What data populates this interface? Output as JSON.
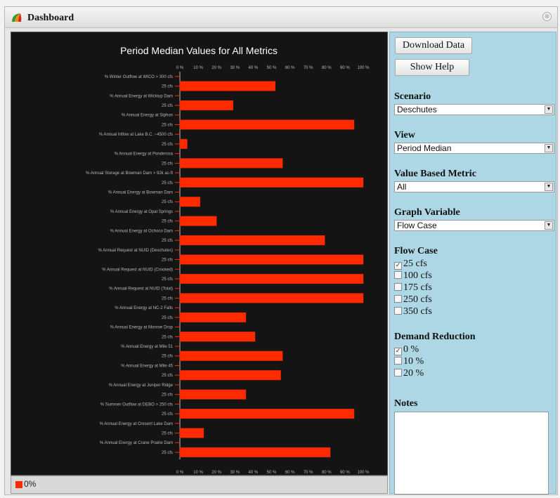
{
  "window": {
    "title": "Dashboard",
    "close_glyph": "⊗"
  },
  "icons": {
    "app": "app-logo-icon",
    "close": "close-icon",
    "dropdown": "dropdown-arrow-icon"
  },
  "chart_data": {
    "type": "bar",
    "orientation": "horizontal",
    "title": "Period Median Values  for All Metrics",
    "xlim": [
      0,
      100
    ],
    "x_ticks": [
      "0 %",
      "10 %",
      "20 %",
      "30 %",
      "40 %",
      "50 %",
      "60 %",
      "70 %",
      "80 %",
      "90 %",
      "100 %"
    ],
    "categories": [
      "% Winter Outflow at WICO > 300 cfs",
      "25 cfs",
      "% Annual Energy at Wickiup Dam",
      "25 cfs",
      "% Annual Energy at Siphon",
      "25 cfs",
      "% Annual Inflow at Lake B.C. ~4500 cfs",
      "25 cfs",
      "% Annual Energy at Ponderosa",
      "25 cfs",
      "% Annual Storage at Bowman Dam > 92k ac-ft",
      "25 cfs",
      "% Annual Energy at Bowman Dam",
      "25 cfs",
      "% Annual Energy at Opal Springs",
      "25 cfs",
      "% Annual Energy at Ochoco Dam",
      "25 cfs",
      "% Annual Request at NUID (Deschutes)",
      "25 cfs",
      "% Annual Request at NUID (Crooked)",
      "25 cfs",
      "% Annual Request at NUID (Total)",
      "25 cfs",
      "% Annual Energy at NC-2 Falls",
      "25 cfs",
      "% Annual Energy at Monroe Drop",
      "25 cfs",
      "% Annual Energy at Mile 51",
      "25 cfs",
      "% Annual Energy at Mile 45",
      "25 cfs",
      "% Annual Energy at Juniper Ridge",
      "25 cfs",
      "% Summer Outflow at DEBO > 250 cfs",
      "25 cfs",
      "% Annual Energy at Cresent Lake Dam",
      "25 cfs",
      "% Annual Energy at Crane Prairie Dam",
      "25 cfs"
    ],
    "series": [
      {
        "name": "0%",
        "color": "#ff2a00",
        "values": [
          null,
          52,
          null,
          29,
          null,
          95,
          null,
          4,
          null,
          56,
          null,
          100,
          null,
          11,
          null,
          20,
          null,
          79,
          null,
          100,
          null,
          100,
          null,
          100,
          null,
          36,
          null,
          41,
          null,
          56,
          null,
          55,
          null,
          36,
          null,
          95,
          null,
          13,
          null,
          82
        ]
      }
    ],
    "legend": [
      "0%"
    ],
    "legend_position": "bottom-left"
  },
  "controls": {
    "download_label": "Download Data",
    "help_label": "Show Help",
    "scenario": {
      "label": "Scenario",
      "value": "Deschutes"
    },
    "view": {
      "label": "View",
      "value": "Period Median"
    },
    "value_metric": {
      "label": "Value Based Metric",
      "value": "All"
    },
    "graph_variable": {
      "label": "Graph Variable",
      "value": "Flow Case"
    },
    "flow_case": {
      "label": "Flow Case",
      "options": [
        {
          "label": "25 cfs",
          "checked": true
        },
        {
          "label": "100 cfs",
          "checked": false
        },
        {
          "label": "175 cfs",
          "checked": false
        },
        {
          "label": "250 cfs",
          "checked": false
        },
        {
          "label": "350 cfs",
          "checked": false
        }
      ]
    },
    "demand_reduction": {
      "label": "Demand Reduction",
      "options": [
        {
          "label": "0 %",
          "checked": true
        },
        {
          "label": "10 %",
          "checked": false
        },
        {
          "label": "20 %",
          "checked": false
        }
      ]
    },
    "notes": {
      "label": "Notes",
      "value": ""
    }
  }
}
